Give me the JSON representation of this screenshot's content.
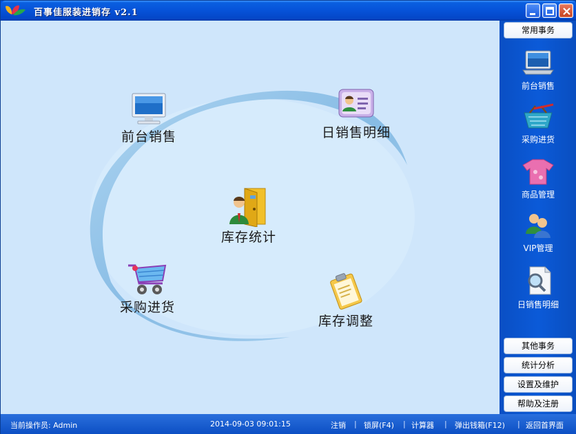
{
  "window": {
    "title": "百事佳服装进销存 v2.1"
  },
  "main": {
    "features": [
      {
        "id": "front-sales",
        "label": "前台销售",
        "icon": "monitor-icon"
      },
      {
        "id": "daily-sales-detail",
        "label": "日销售明细",
        "icon": "id-card-icon"
      },
      {
        "id": "inventory-stats",
        "label": "库存统计",
        "icon": "door-person-icon"
      },
      {
        "id": "purchase",
        "label": "采购进货",
        "icon": "shopping-cart-icon"
      },
      {
        "id": "inventory-adjust",
        "label": "库存调整",
        "icon": "clipboard-icon"
      }
    ]
  },
  "sidebar": {
    "top_button": "常用事务",
    "items": [
      {
        "label": "前台销售",
        "icon": "laptop-icon"
      },
      {
        "label": "采购进货",
        "icon": "basket-icon"
      },
      {
        "label": "商品管理",
        "icon": "tshirt-icon"
      },
      {
        "label": "VIP管理",
        "icon": "users-icon"
      },
      {
        "label": "日销售明细",
        "icon": "document-search-icon"
      }
    ],
    "bottom_buttons": [
      "其他事务",
      "统计分析",
      "设置及维护",
      "帮助及注册"
    ]
  },
  "status": {
    "operator": "当前操作员: Admin",
    "datetime": "2014-09-03 09:01:15",
    "links": [
      "注销",
      "锁屏(F4)",
      "计算器",
      "弹出钱箱(F12)",
      "返回首界面"
    ],
    "separator": "|"
  },
  "colors": {
    "titlebar": "#0652d8",
    "main_bg": "#cfe6fb",
    "sidebar": "#0b5ad8",
    "ellipse": "#8fc1e8"
  }
}
